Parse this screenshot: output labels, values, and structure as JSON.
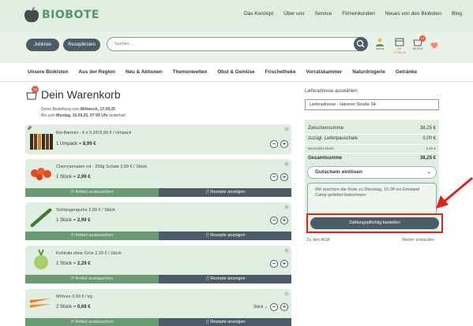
{
  "brand": {
    "name": "BIOBOTE",
    "accent": "#59936b"
  },
  "top_nav": [
    "Das Konzept",
    "Über uns",
    "Service",
    "Firmenkunden",
    "Neues von den Bioboten",
    "Blog"
  ],
  "toolbar": {
    "jobkiste_label": "Jobkiste",
    "rezeptkisten_label": "Rezeptkisten",
    "search_placeholder": "Suchen ...",
    "account_label": "Alexa",
    "date_label": "Mi.",
    "date_value": "17.09.25",
    "cart_count": "13",
    "cart_total": "38,25 €"
  },
  "categories": [
    "Unsere Biokisten",
    "Aus der Region",
    "Neu & Aktionen",
    "Themenwelten",
    "Obst & Gemüse",
    "Frischetheke",
    "Vorratskammer",
    "Naturdrogerie",
    "Getränke"
  ],
  "cart": {
    "title": "Dein Warenkorb",
    "badge": "13",
    "delivery_prefix": "Deine Bestellung zum ",
    "delivery_date": "Mittwoch, 17.09.25",
    "deadline_prefix": "Bis zum ",
    "deadline_value": "Montag, 15.09.25, 07:59 Uhr",
    "deadline_suffix": " änderbar!"
  },
  "items": [
    {
      "name": "Bio-Biermix - 6 x 0,33l 8,99 € / Umpack",
      "qty": "1 Umpack",
      "price": "8,99 €"
    },
    {
      "name": "Cherrytomaten rot - 250g Schale 2,99 € / Stück",
      "qty": "1 Stück",
      "price": "2,99 €",
      "exchange": "Artikel austauschen",
      "recipes": "Rezepte anzeigen"
    },
    {
      "name": "Schlangengurke 2,99 € / Stück",
      "qty": "1 Stück",
      "price": "2,99 €",
      "exchange": "Artikel austauschen",
      "recipes": "Rezepte anzeigen"
    },
    {
      "name": "Kohlrabi ohne Grün 2,29 € / Stück",
      "qty": "1 Stück",
      "price": "2,29 €",
      "exchange": "Artikel austauschen",
      "recipes": "Rezepte anzeigen"
    },
    {
      "name": "Möhren 3,99 € / kg",
      "qty": "2 Stück",
      "price": "0,68 €",
      "unit": "Stück",
      "exchange": "Artikel austauschen",
      "recipes": "Rezepte anzeigen"
    }
  ],
  "summary": {
    "address_label": "Lieferadresse auswählen",
    "address_value": "Lieferadresse - Harener Straße 34",
    "subtotal_label": "Zwischensumme",
    "subtotal_value": "38,25 €",
    "delivery_label": "zuzügl. Lieferpauschale",
    "delivery_value": "0,00 €",
    "tax_label": "Beinhaltet MwSt.",
    "tax_value": "5,89 €",
    "total_label": "Gesamtsumme",
    "total_value": "38,25 €",
    "voucher_label": "Gutschein einlösen",
    "comment": "Wir möchten die Kiste zu Dienstag, 16.09 ins Emsland Camp geliefert bekommen",
    "order_label": "Zahlungspflichtig bestellen",
    "agb_link": "Zu den AGB",
    "continue_link": "Weiter einkaufen"
  }
}
